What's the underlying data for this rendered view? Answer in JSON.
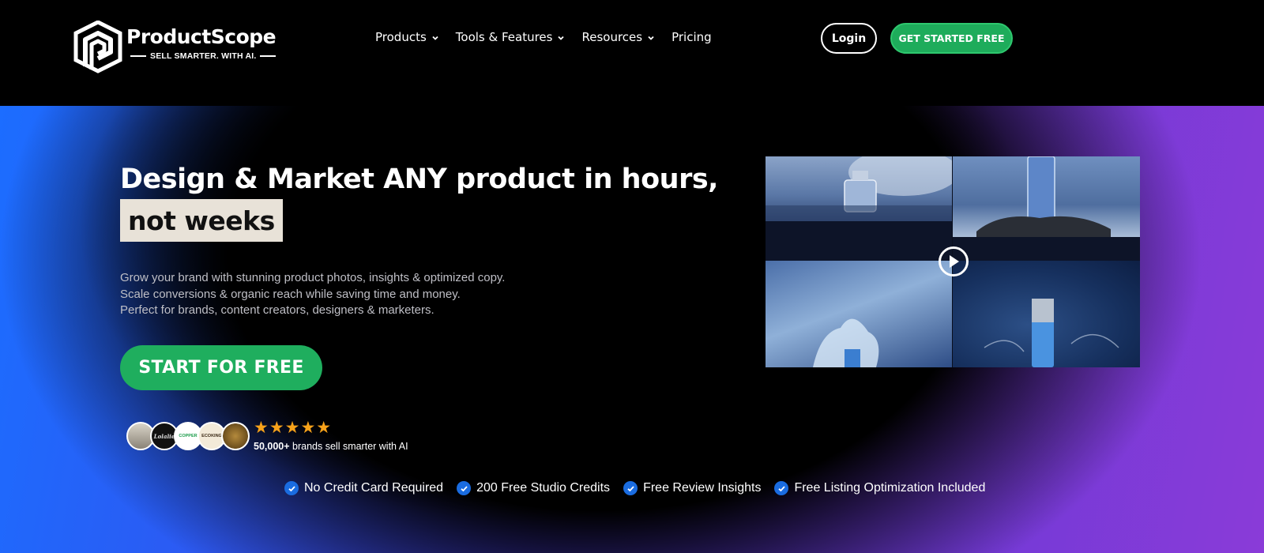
{
  "brand": {
    "name": "ProductScope",
    "tagline": "SELL SMARTER. WITH AI."
  },
  "nav": {
    "items": [
      {
        "label": "Products",
        "dropdown": true
      },
      {
        "label": "Tools & Features",
        "dropdown": true
      },
      {
        "label": "Resources",
        "dropdown": true
      },
      {
        "label": "Pricing",
        "dropdown": false
      }
    ],
    "login_label": "Login",
    "get_started_label": "GET STARTED FREE"
  },
  "hero": {
    "title_line1": "Design & Market ANY product in hours,",
    "title_highlight": "not weeks",
    "description": [
      "Grow your brand with stunning product photos, insights & optimized copy.",
      "Scale conversions & organic reach while saving time and money.",
      "Perfect for brands, content creators, designers & marketers."
    ],
    "cta_label": "START FOR FREE"
  },
  "social_proof": {
    "stars": "★★★★★",
    "count": "50,000+",
    "text": " brands sell smarter with AI",
    "avatars": [
      {
        "name": "brand-avatar-1",
        "label": ""
      },
      {
        "name": "brand-avatar-2",
        "label": "Lolalie"
      },
      {
        "name": "brand-avatar-3",
        "label": "COPPER"
      },
      {
        "name": "brand-avatar-4",
        "label": "ECOKING"
      },
      {
        "name": "brand-avatar-5",
        "label": ""
      }
    ]
  },
  "features": [
    "No Credit Card Required",
    "200 Free Studio Credits",
    "Free Review Insights",
    "Free Listing Optimization Included"
  ],
  "colors": {
    "accent_green": "#1fae5e",
    "check_blue": "#1a6ce0",
    "star_orange": "#f7a21a",
    "gradient_blue": "#1c6dff",
    "gradient_purple": "#8a3bd8"
  }
}
